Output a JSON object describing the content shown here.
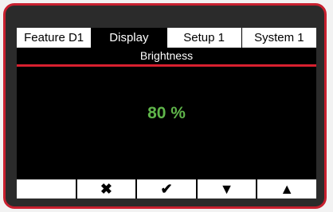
{
  "tabs": [
    {
      "label": "Feature  D1",
      "active": false
    },
    {
      "label": "Display",
      "active": true
    },
    {
      "label": "Setup 1",
      "active": false
    },
    {
      "label": "System 1",
      "active": false
    }
  ],
  "screen": {
    "subtitle": "Brightness",
    "value": "80 %"
  },
  "softkeys": [
    {
      "icon": "blank",
      "glyph": ""
    },
    {
      "icon": "close-icon",
      "glyph": "✖"
    },
    {
      "icon": "check-icon",
      "glyph": "✔"
    },
    {
      "icon": "down-arrow-icon",
      "glyph": "▼"
    },
    {
      "icon": "up-arrow-icon",
      "glyph": "▲"
    }
  ],
  "colors": {
    "frame_red": "#c8202f",
    "divider_red": "#d8202f",
    "value_green": "#5fb54a"
  }
}
